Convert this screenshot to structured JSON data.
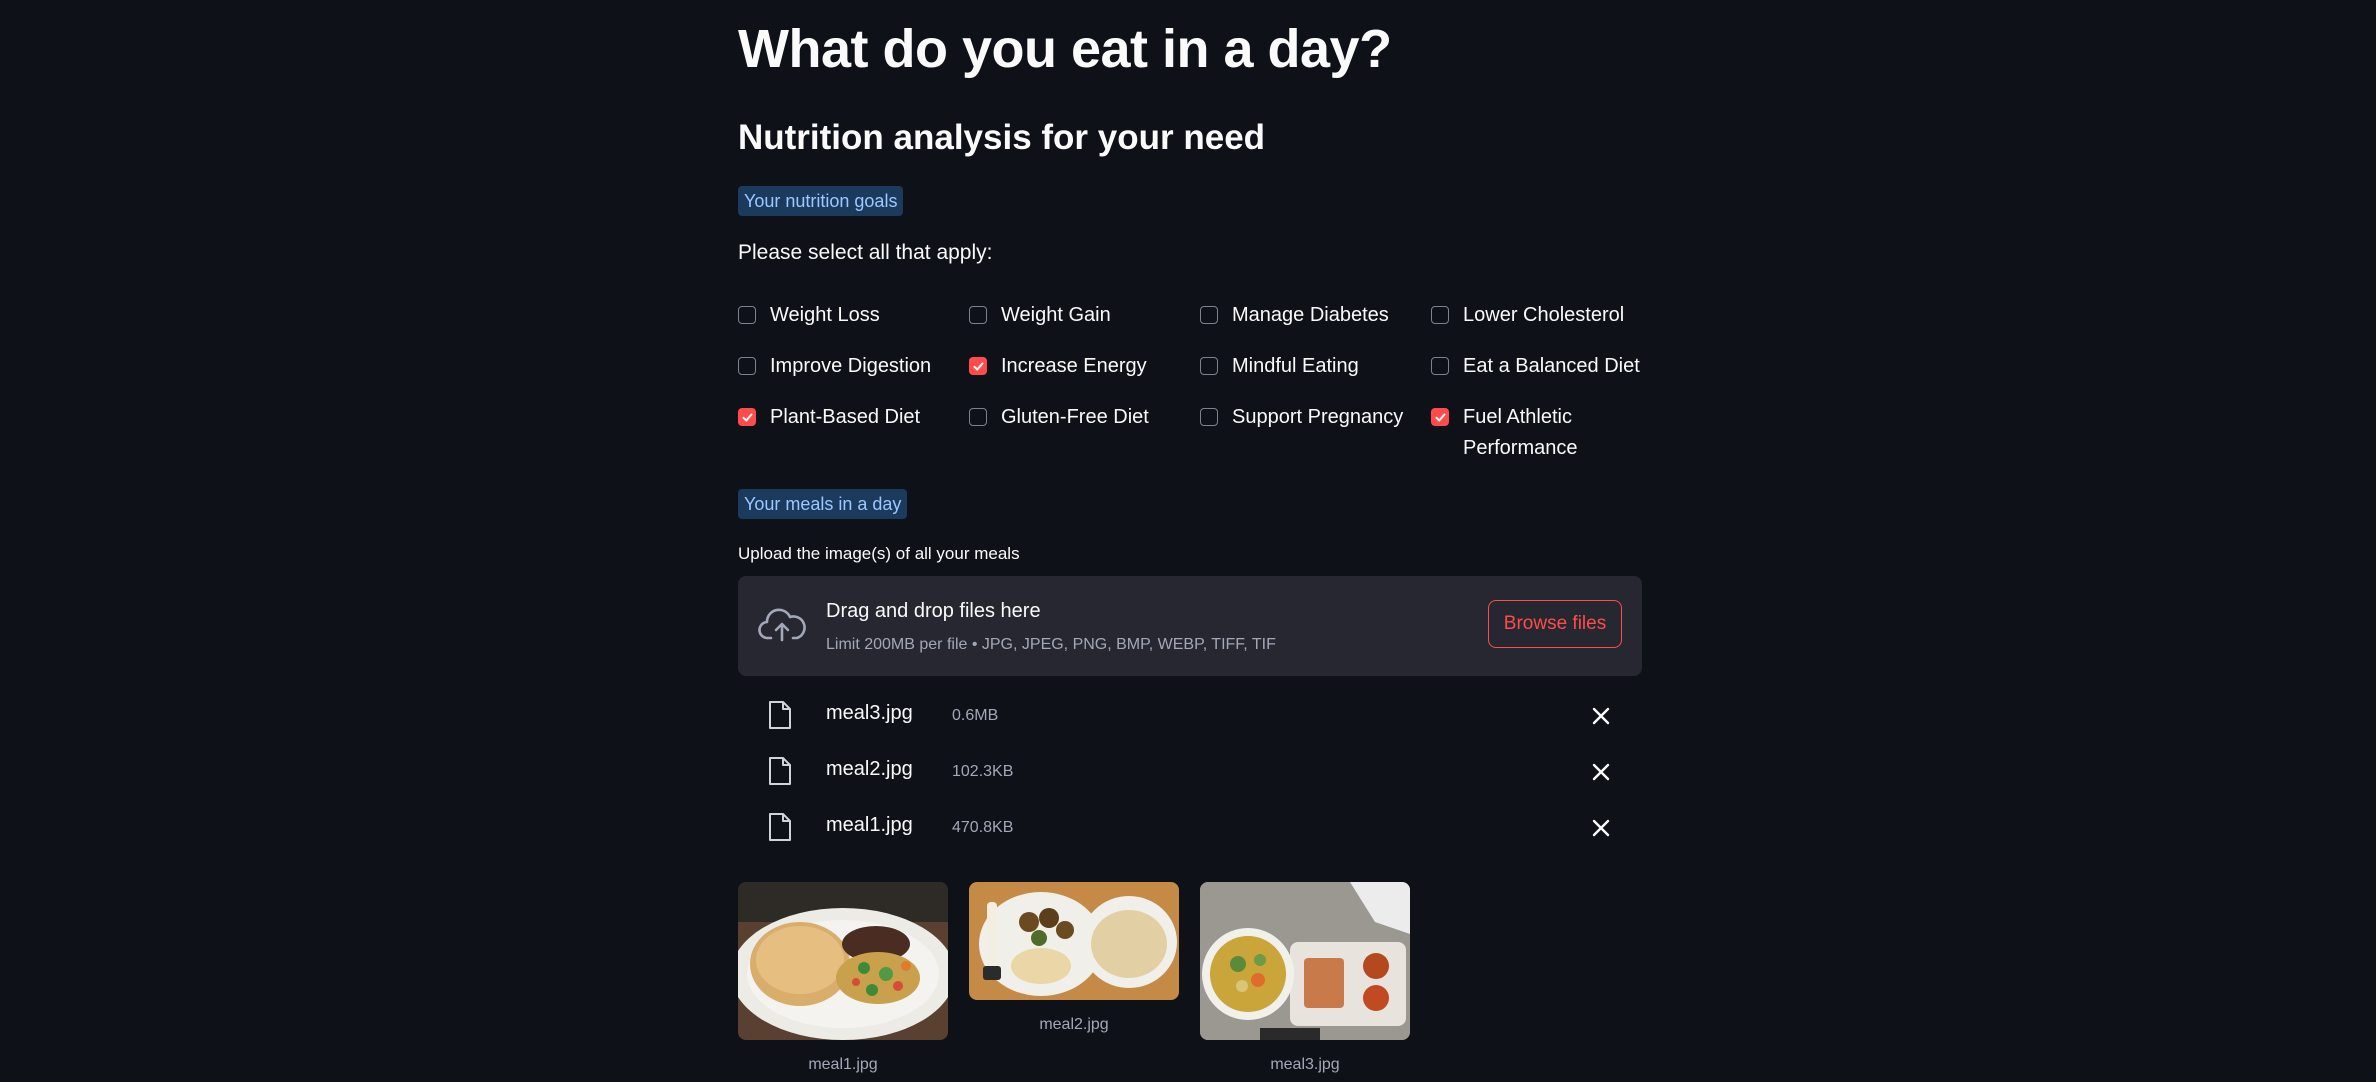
{
  "header": {
    "title": "What do you eat in a day?",
    "subtitle": "Nutrition analysis for your need"
  },
  "goals": {
    "tag": "Your nutrition goals",
    "prompt": "Please select all that apply:",
    "options": [
      {
        "label": "Weight Loss",
        "checked": false
      },
      {
        "label": "Weight Gain",
        "checked": false
      },
      {
        "label": "Manage Diabetes",
        "checked": false
      },
      {
        "label": "Lower Cholesterol",
        "checked": false
      },
      {
        "label": "Improve Digestion",
        "checked": false
      },
      {
        "label": "Increase Energy",
        "checked": true
      },
      {
        "label": "Mindful Eating",
        "checked": false
      },
      {
        "label": "Eat a Balanced Diet",
        "checked": false
      },
      {
        "label": "Plant-Based Diet",
        "checked": true
      },
      {
        "label": "Gluten-Free Diet",
        "checked": false
      },
      {
        "label": "Support Pregnancy",
        "checked": false
      },
      {
        "label": "Fuel Athletic Performance",
        "checked": true
      }
    ]
  },
  "meals": {
    "tag": "Your meals in a day",
    "upload_label": "Upload the image(s) of all your meals",
    "dropzone_title": "Drag and drop files here",
    "dropzone_limit": "Limit 200MB per file • JPG, JPEG, PNG, BMP, WEBP, TIFF, TIF",
    "browse_label": "Browse files",
    "files": [
      {
        "name": "meal3.jpg",
        "size": "0.6MB"
      },
      {
        "name": "meal2.jpg",
        "size": "102.3KB"
      },
      {
        "name": "meal1.jpg",
        "size": "470.8KB"
      }
    ],
    "thumbnails": [
      {
        "caption": "meal1.jpg"
      },
      {
        "caption": "meal2.jpg"
      },
      {
        "caption": "meal3.jpg"
      }
    ]
  },
  "colors": {
    "background": "#0e1117",
    "accent": "#ff4b4b",
    "tag_bg": "#1c3a5e",
    "tag_text": "#9cc7ff",
    "dropzone_bg": "#262730"
  }
}
